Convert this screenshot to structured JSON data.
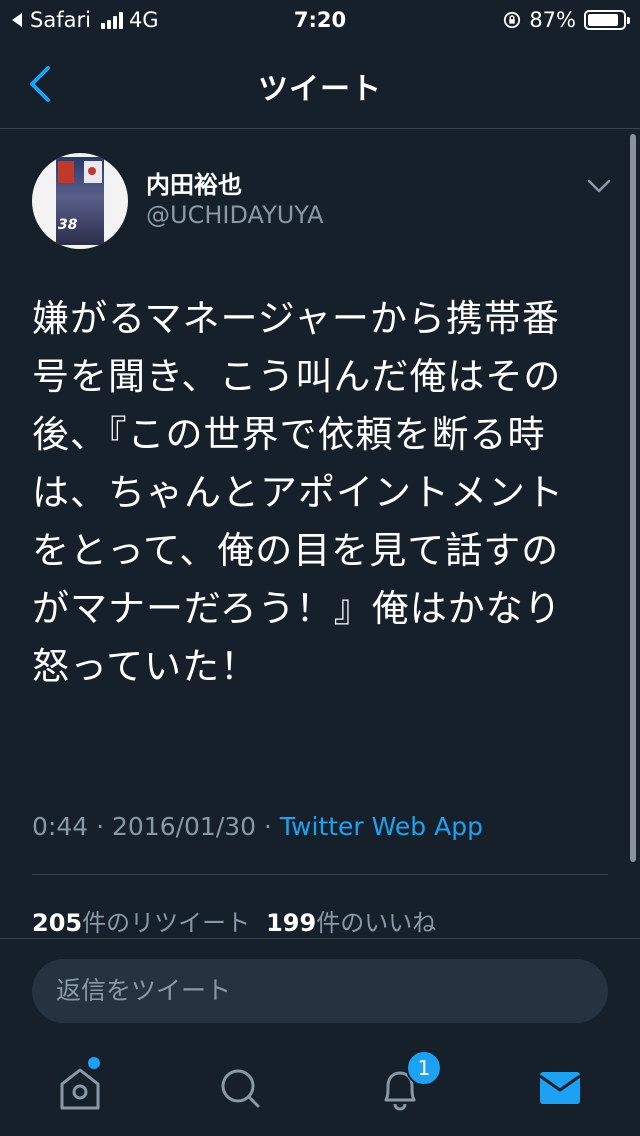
{
  "status_bar": {
    "carrier": "Safari",
    "network": "4G",
    "time": "7:20",
    "battery": "87%"
  },
  "header": {
    "title": "ツイート"
  },
  "tweet": {
    "display_name": "内田裕也",
    "handle": "@UCHIDAYUYA",
    "avatar_text": "38",
    "text": "嫌がるマネージャーから携帯番号を聞き、こう叫んだ俺はその後、『この世界で依頼を断る時は、ちゃんとアポイントメントをとって、俺の目を見て話すのがマナーだろう！』俺はかなり怒っていた！",
    "time": "0:44",
    "date": "2016/01/30",
    "separator": " · ",
    "source_app": "Twitter Web App",
    "retweet_count": "205",
    "retweet_label": "件のリツイート",
    "like_count": "199",
    "like_label": "件のいいね"
  },
  "reply": {
    "placeholder": "返信をツイート"
  },
  "tabbar": {
    "notification_badge": "1",
    "accent_color": "#1da1f2"
  },
  "colors": {
    "background": "#15202b",
    "secondary_text": "#8899a6",
    "link": "#1da1f2",
    "divider": "#38444d"
  }
}
